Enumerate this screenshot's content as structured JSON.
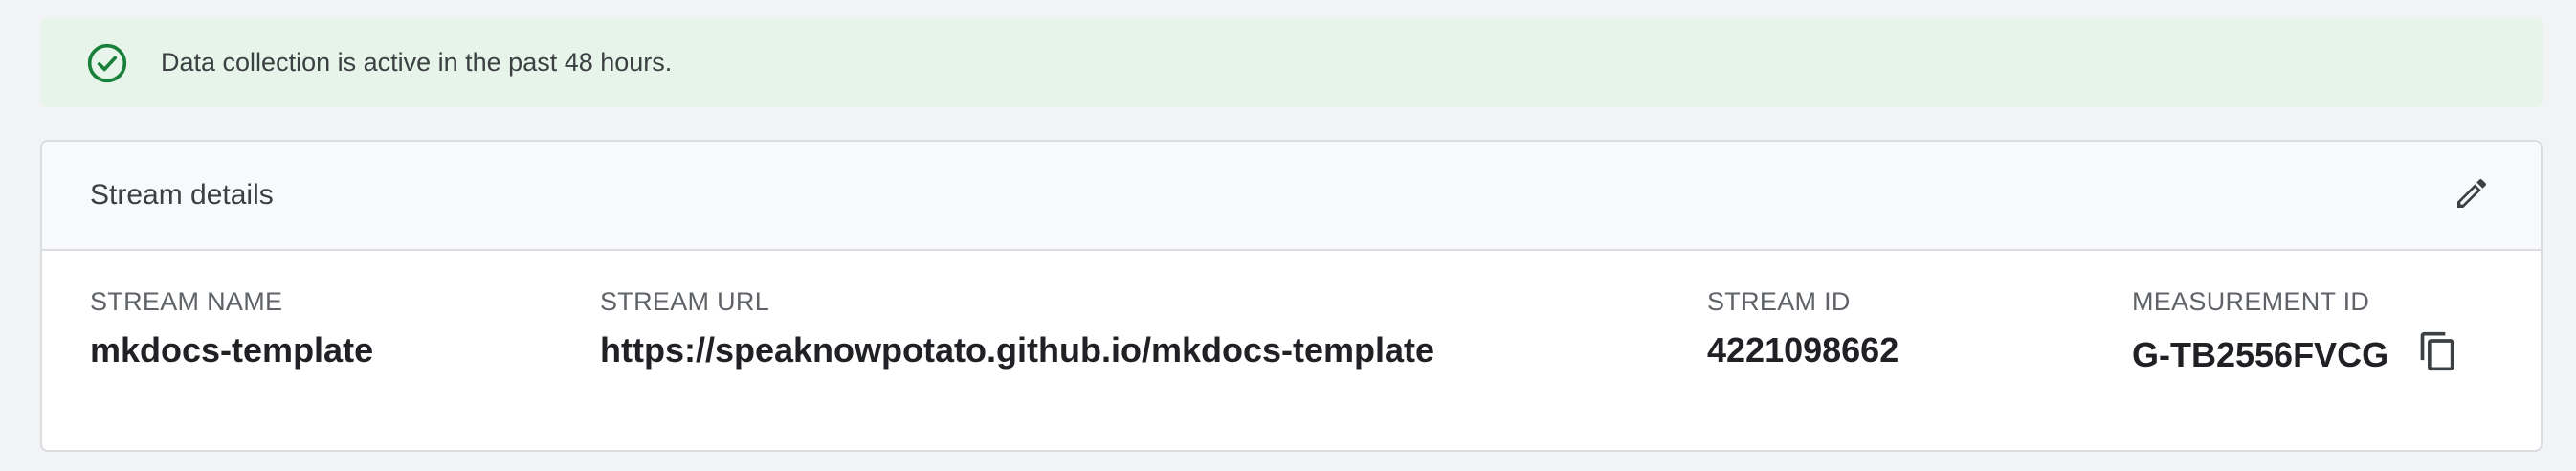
{
  "banner": {
    "icon": "check-circle-icon",
    "text": "Data collection is active in the past 48 hours.",
    "color": "#188038",
    "background": "#e6f4ea"
  },
  "stream_details": {
    "title": "Stream details",
    "edit_icon": "pencil-icon",
    "copy_icon": "copy-icon",
    "fields": {
      "stream_name": {
        "label": "STREAM NAME",
        "value": "mkdocs-template"
      },
      "stream_url": {
        "label": "STREAM URL",
        "value": "https://speaknowpotato.github.io/mkdocs-template"
      },
      "stream_id": {
        "label": "STREAM ID",
        "value": "4221098662"
      },
      "measurement_id": {
        "label": "MEASUREMENT ID",
        "value": "G-TB2556FVCG"
      }
    }
  }
}
